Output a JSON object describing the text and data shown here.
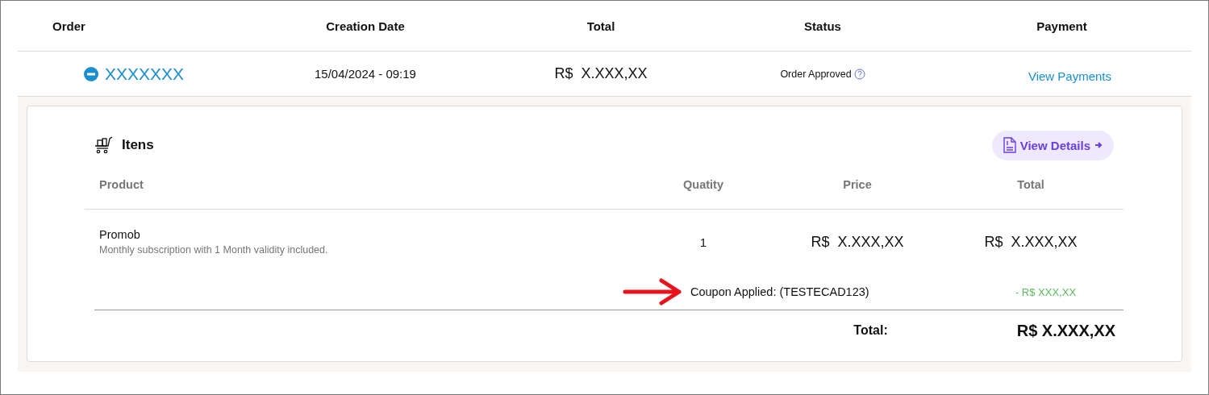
{
  "orders_table": {
    "columns": [
      "Order",
      "Creation Date",
      "Total",
      "Status",
      "Payment"
    ],
    "row": {
      "expanded": true,
      "order": "XXXXXXX",
      "creation_date": "15/04/2024 - 09:19",
      "total": "R$  X.XXX,XX",
      "status": "Order Approved",
      "payment_link": "View Payments"
    }
  },
  "items_panel": {
    "title": "Itens",
    "details_button": "View Details",
    "columns": [
      "Product",
      "Quatity",
      "Price",
      "Total"
    ],
    "items": [
      {
        "product": "Promob",
        "description": "Monthly subscription with 1 Month validity included.",
        "quantity": "1",
        "price": "R$  X.XXX,XX",
        "total": "R$  X.XXX,XX"
      }
    ],
    "coupon": {
      "label": "Coupon Applied: (TESTECAD123)",
      "discount": "- R$ XXX,XX"
    },
    "grand_total": {
      "label": "Total:",
      "value": "R$ X.XXX,XX"
    }
  }
}
